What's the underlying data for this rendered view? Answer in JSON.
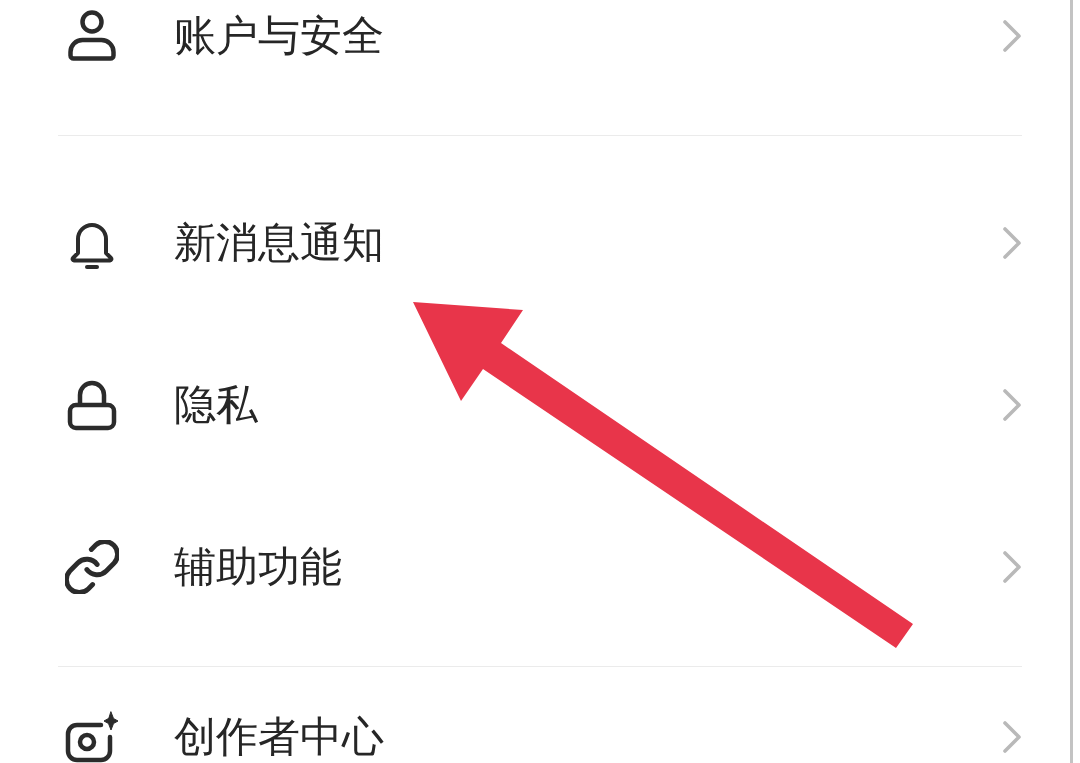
{
  "settings_list": {
    "groups": [
      {
        "items": [
          {
            "label": "账户与安全"
          }
        ]
      },
      {
        "items": [
          {
            "label": "新消息通知"
          },
          {
            "label": "隐私"
          },
          {
            "label": "辅助功能"
          }
        ]
      },
      {
        "items": [
          {
            "label": "创作者中心"
          }
        ]
      }
    ]
  }
}
